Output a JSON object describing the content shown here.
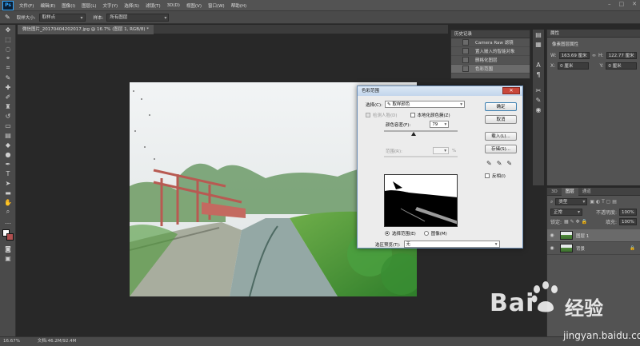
{
  "app": {
    "logo": "Ps"
  },
  "menu": [
    "文件(F)",
    "编辑(E)",
    "图像(I)",
    "图层(L)",
    "文字(Y)",
    "选择(S)",
    "滤镜(T)",
    "3D(D)",
    "视图(V)",
    "窗口(W)",
    "帮助(H)"
  ],
  "window_controls": [
    "–",
    "□",
    "✕"
  ],
  "options_bar": {
    "sample_size_label": "取样大小:",
    "sample_size_value": "取样点",
    "sample_label": "样本:",
    "sample_value": "所有图层"
  },
  "document": {
    "tab_title": "微信图片_20170404202017.jpg @ 16.7% (图层 1, RGB/8) *"
  },
  "status": {
    "zoom": "16.67%",
    "doc_info": "文档:46.2M/92.4M"
  },
  "history": {
    "title": "历史记录",
    "items": [
      "Camera Raw 滤镜",
      "置入嵌入的智能对象",
      "删格化图层",
      "色彩范围"
    ]
  },
  "properties": {
    "title": "属性",
    "subtitle": "像素图层属性",
    "w_label": "W:",
    "w_value": "163.69 厘米",
    "h_label": "H:",
    "h_value": "122.77 厘米",
    "x_label": "X:",
    "x_value": "0 厘米",
    "y_label": "Y:",
    "y_value": "0 厘米"
  },
  "layers": {
    "tabs": [
      "3D",
      "图层",
      "通道"
    ],
    "kind_label": "类型",
    "blend_mode": "正常",
    "opacity_label": "不透明度:",
    "opacity_value": "100%",
    "lock_label": "锁定:",
    "fill_label": "填充:",
    "fill_value": "100%",
    "items": [
      {
        "name": "图层 1",
        "selected": true
      },
      {
        "name": "背景",
        "selected": false,
        "locked": true
      }
    ]
  },
  "dialog": {
    "title": "色彩范围",
    "close": "✕",
    "select_label": "选择(C):",
    "select_value": "取样颜色",
    "detect_faces": "检测人脸(D)",
    "localized": "本地化颜色簇(Z)",
    "fuzziness_label": "颜色容差(F):",
    "fuzziness_value": "79",
    "fuzziness_fraction": 0.4,
    "range_label": "范围(R):",
    "range_unit": "%",
    "radio_selection": "选择范围(E)",
    "radio_image": "图像(M)",
    "preview_label": "选区预览(T):",
    "preview_value": "无",
    "buttons": {
      "ok": "确定",
      "cancel": "取消",
      "load": "载入(L)...",
      "save": "存储(S)..."
    },
    "invert": "反相(I)"
  },
  "watermark": {
    "brand": "Bai",
    "brand_suffix": "经验",
    "url": "jingyan.baidu.com"
  },
  "colors": {
    "app_bg": "#282828",
    "panel": "#535353",
    "accent": "#31a8ff",
    "dialog_bg": "#ececec",
    "close_red": "#c9473b"
  }
}
